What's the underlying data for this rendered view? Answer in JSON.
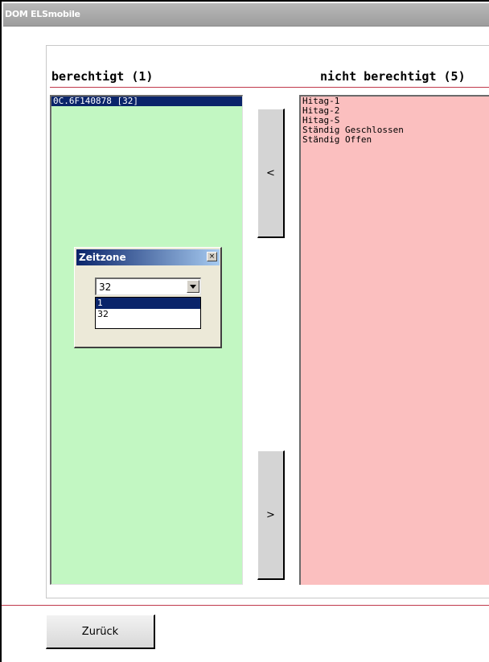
{
  "window": {
    "title": "DOM ELSmobile"
  },
  "headers": {
    "authorized": "berechtigt (1)",
    "not_authorized": "nicht berechtigt (5)"
  },
  "authorized_list": [
    {
      "label": "0C.6F140878 [32]",
      "selected": true
    }
  ],
  "not_authorized_list": [
    {
      "label": "Hitag-1"
    },
    {
      "label": "Hitag-2"
    },
    {
      "label": "Hitag-S"
    },
    {
      "label": "Ständig Geschlossen"
    },
    {
      "label": "Ständig Offen"
    }
  ],
  "move_buttons": {
    "add_label": "<",
    "remove_label": ">"
  },
  "dialog": {
    "title": "Zeitzone",
    "close_glyph": "×",
    "select_value": "32",
    "options": [
      {
        "label": "1",
        "selected": true
      },
      {
        "label": "32",
        "selected": false
      }
    ]
  },
  "footer": {
    "back_label": "Zurück"
  },
  "colors": {
    "authorized_bg": "#c2f7c2",
    "not_authorized_bg": "#fbbfbf",
    "selection": "#0a246a",
    "accent_line": "#c0394b"
  }
}
